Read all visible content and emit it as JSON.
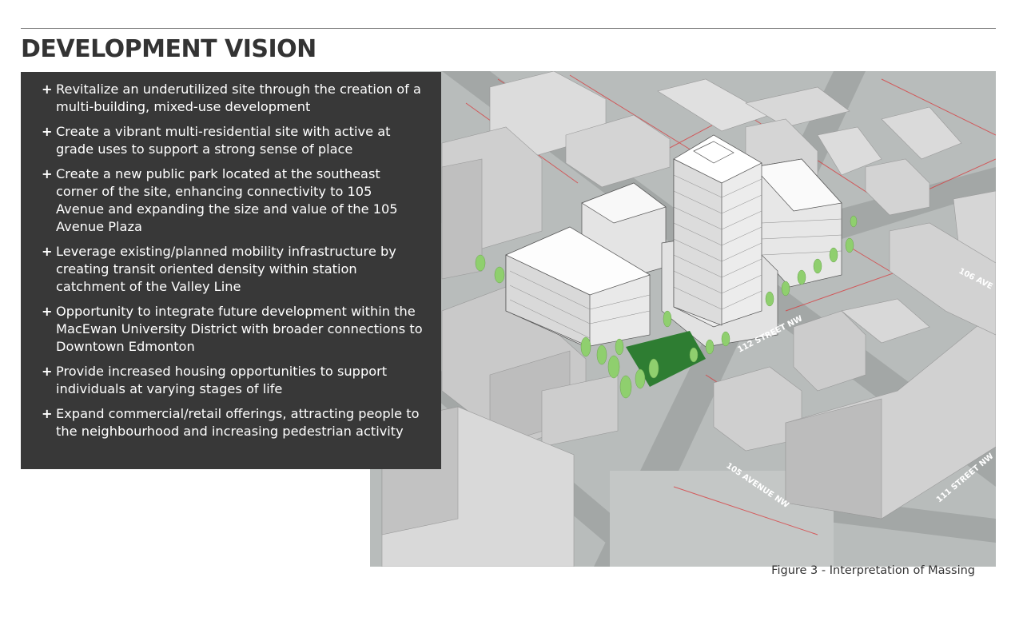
{
  "page": {
    "title": "DEVELOPMENT VISION",
    "caption": "Figure 3 - Interpretation of Massing"
  },
  "bullets": [
    {
      "mark": "+",
      "text": "Revitalize an underutilized site through the creation of a multi-building, mixed-use development"
    },
    {
      "mark": "+",
      "text": "Create a vibrant multi-residential site with active at grade uses to support a strong sense of place"
    },
    {
      "mark": "+",
      "text": "Create a new public park located at the southeast corner of the site, enhancing connectivity to 105 Avenue and expanding the size and value of the 105 Avenue Plaza"
    },
    {
      "mark": "+",
      "text": "Leverage existing/planned mobility infrastructure by creating transit oriented density within station catchment of the Valley Line"
    },
    {
      "mark": "+",
      "text": "Opportunity to integrate future development within the MacEwan University District with broader connections to Downtown Edmonton"
    },
    {
      "mark": "+",
      "text": "Provide increased housing opportunities to support individuals at varying stages of life"
    },
    {
      "mark": "+",
      "text": "Expand commercial/retail offerings, attracting people to the neighbourhood and increasing pedestrian activity"
    }
  ],
  "map_labels": {
    "street_112": "112 STREET NW",
    "avenue_105": "105 AVENUE NW",
    "street_111": "111 STREET NW",
    "avenue_106": "106 AVE"
  },
  "colors": {
    "panel": "#383838",
    "title": "#333333",
    "park": "#2e7d32",
    "trees": "#8fcf6e",
    "property_lines": "#d9393b"
  }
}
